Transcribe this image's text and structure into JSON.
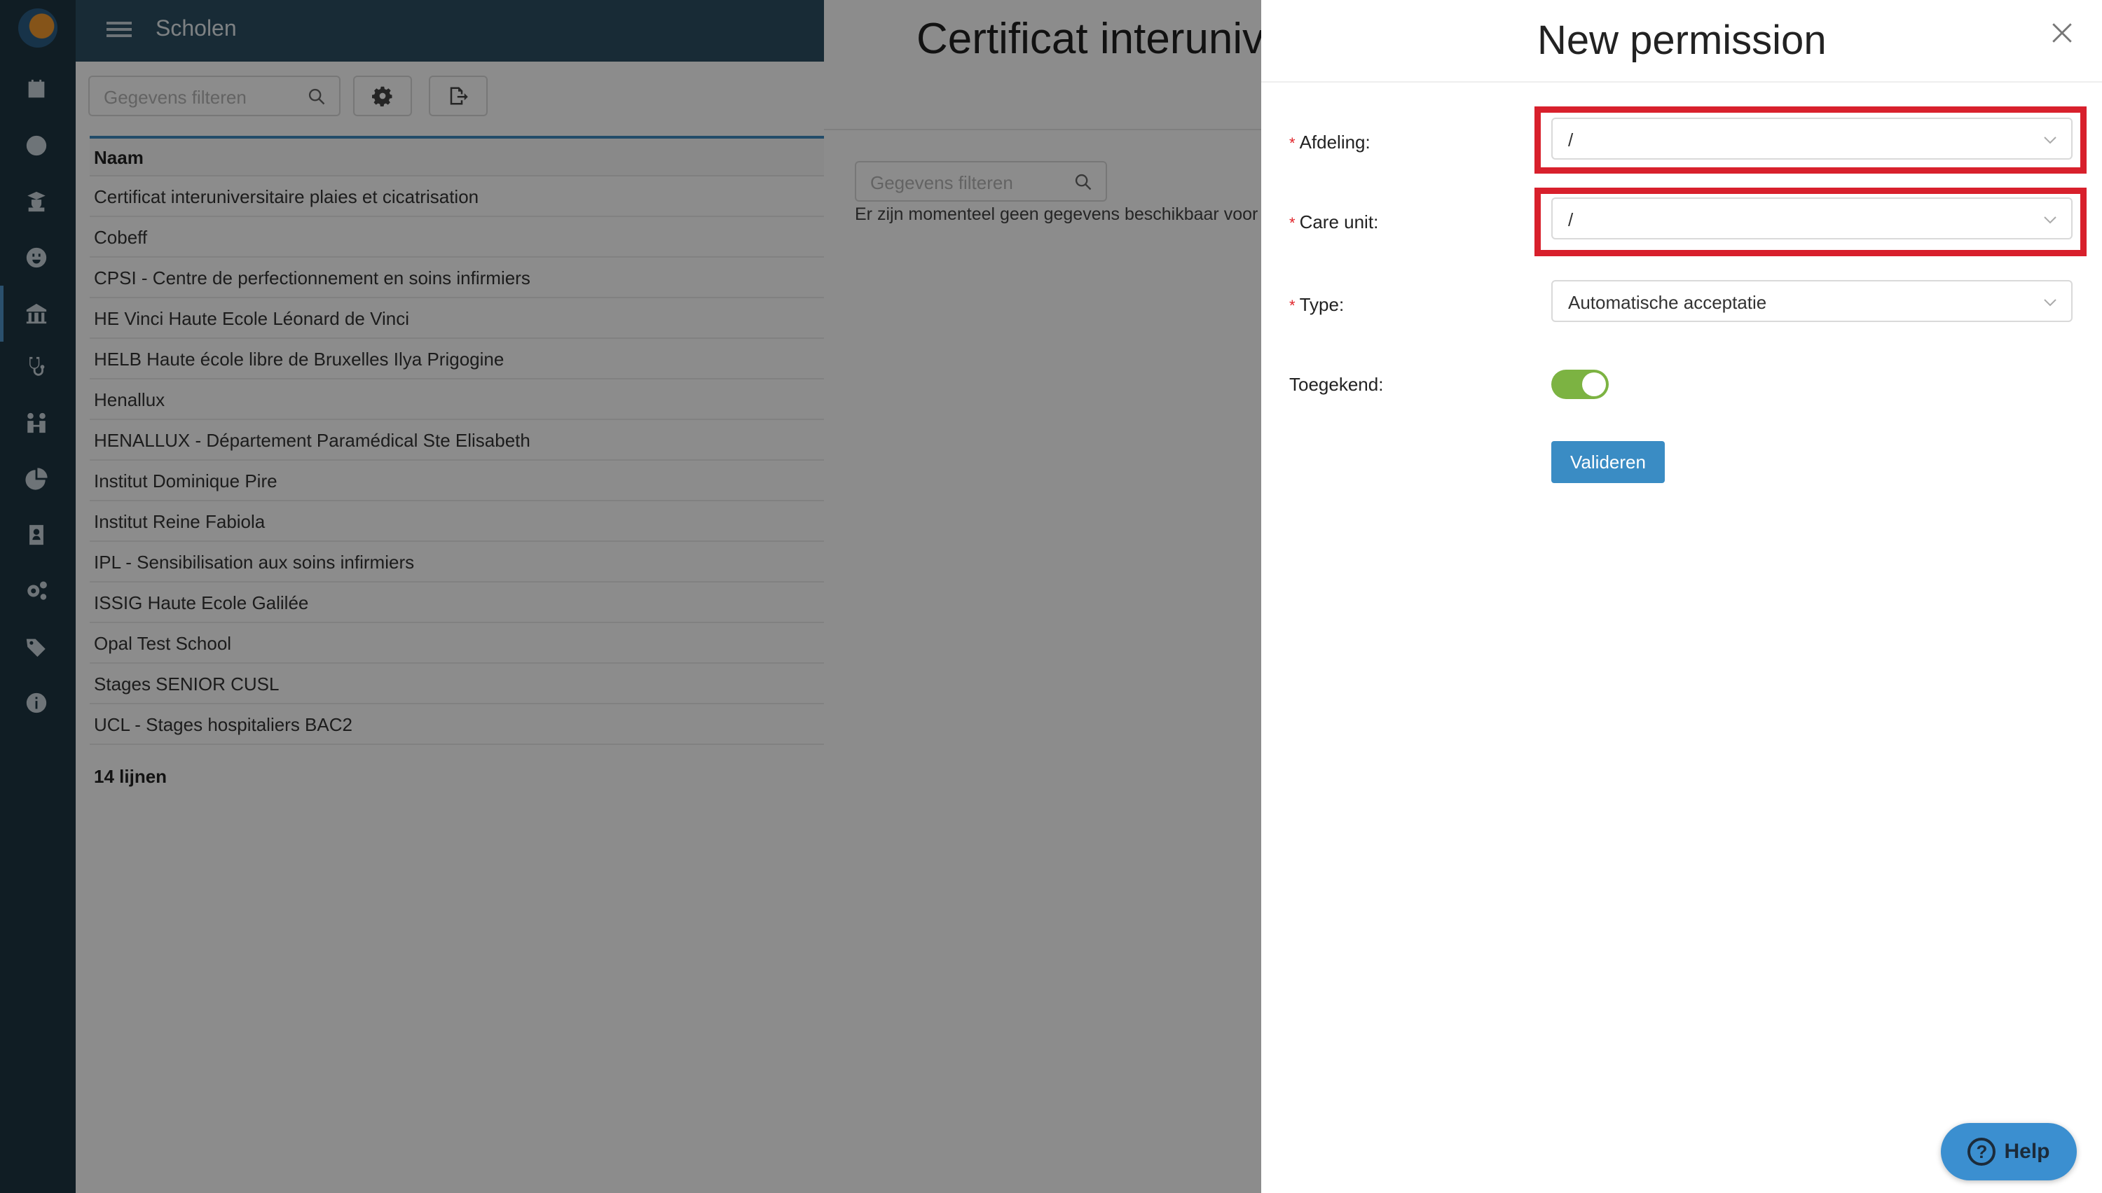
{
  "topbar": {
    "title": "Scholen"
  },
  "list": {
    "filter_placeholder": "Gegevens filteren",
    "column_name": "Naam",
    "schools": [
      "Certificat interuniversitaire plaies et cicatrisation",
      "Cobeff",
      "CPSI - Centre de perfectionnement en soins infirmiers",
      "HE Vinci Haute Ecole Léonard de Vinci",
      "HELB Haute école libre de Bruxelles Ilya Prigogine",
      "Henallux",
      "HENALLUX - Département Paramédical Ste Elisabeth",
      "Institut Dominique Pire",
      "Institut Reine Fabiola",
      "IPL - Sensibilisation aux soins infirmiers",
      "ISSIG Haute Ecole Galilée",
      "Opal Test School",
      "Stages SENIOR CUSL",
      "UCL - Stages hospitaliers BAC2"
    ],
    "count": "14 lijnen"
  },
  "detail": {
    "title": "Certificat interuniversitaire plaies et cicatrisation",
    "filter_placeholder": "Gegevens filteren",
    "empty_text": "Er zijn momenteel geen gegevens beschikbaar voor"
  },
  "drawer": {
    "title": "New permission",
    "fields": {
      "afdeling_label": "Afdeling",
      "afdeling_value": "/",
      "careunit_label": "Care unit",
      "careunit_value": "/",
      "type_label": "Type",
      "type_value": "Automatische acceptatie",
      "toegekend_label": "Toegekend",
      "toegekend_on": true
    },
    "submit_label": "Valideren",
    "colon": ":",
    "required_mark": "*"
  },
  "help": {
    "label": "Help",
    "glyph": "?"
  },
  "colors": {
    "accent": "#3a8cc4",
    "sidebar": "#1e3542",
    "toggle": "#7cb342",
    "highlight": "#d8202c"
  }
}
